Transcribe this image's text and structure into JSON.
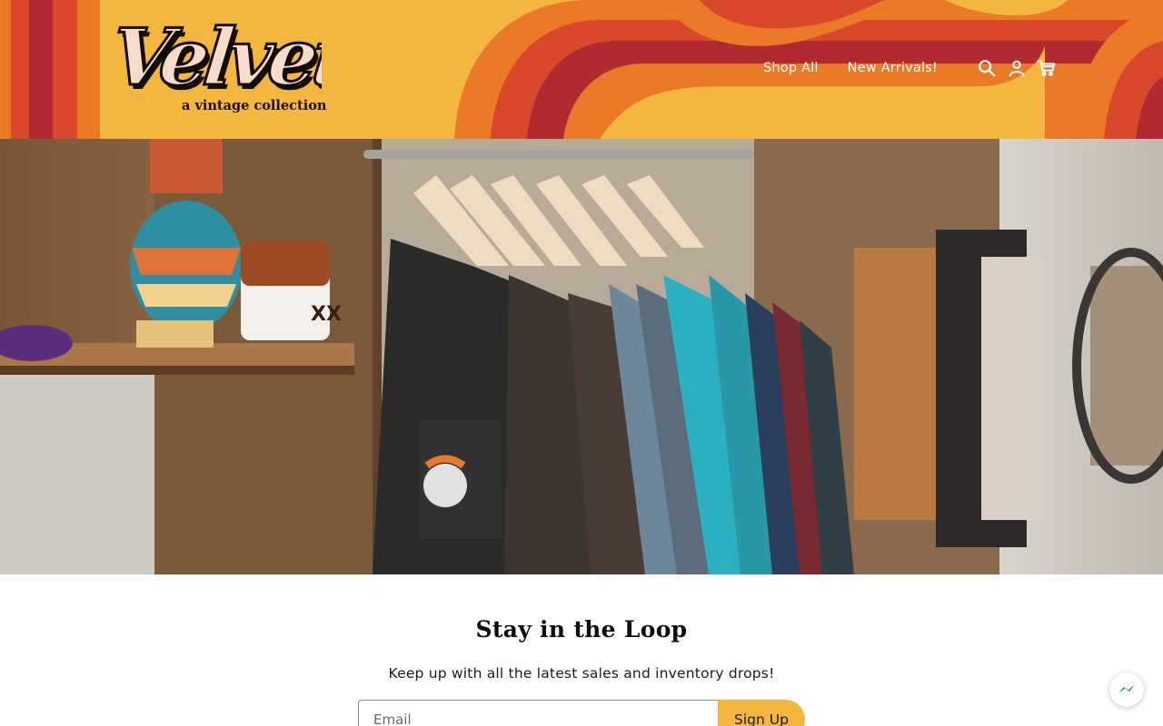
{
  "brand": {
    "logo_text": "Velvet",
    "tagline": "a vintage collection"
  },
  "nav": {
    "links": [
      {
        "label": "Shop All"
      },
      {
        "label": "New Arrivals!"
      }
    ],
    "icons": [
      "search-icon",
      "account-icon",
      "cart-icon"
    ]
  },
  "colors": {
    "mustard": "#f3b63f",
    "orange": "#ea7a28",
    "red_orange": "#d9482b",
    "crimson": "#b12a2f",
    "logo_fill": "#f7dccb",
    "logo_outline": "#130c08"
  },
  "hero": {
    "image_alt": "Vintage clothing rack with t-shirts, shelves with pottery and mugs"
  },
  "newsletter": {
    "title": "Stay in the Loop",
    "subtitle": "Keep up with all the latest sales and inventory drops!",
    "email_placeholder": "Email",
    "button_label": "Sign Up"
  },
  "chat": {
    "icon": "messenger-icon"
  }
}
